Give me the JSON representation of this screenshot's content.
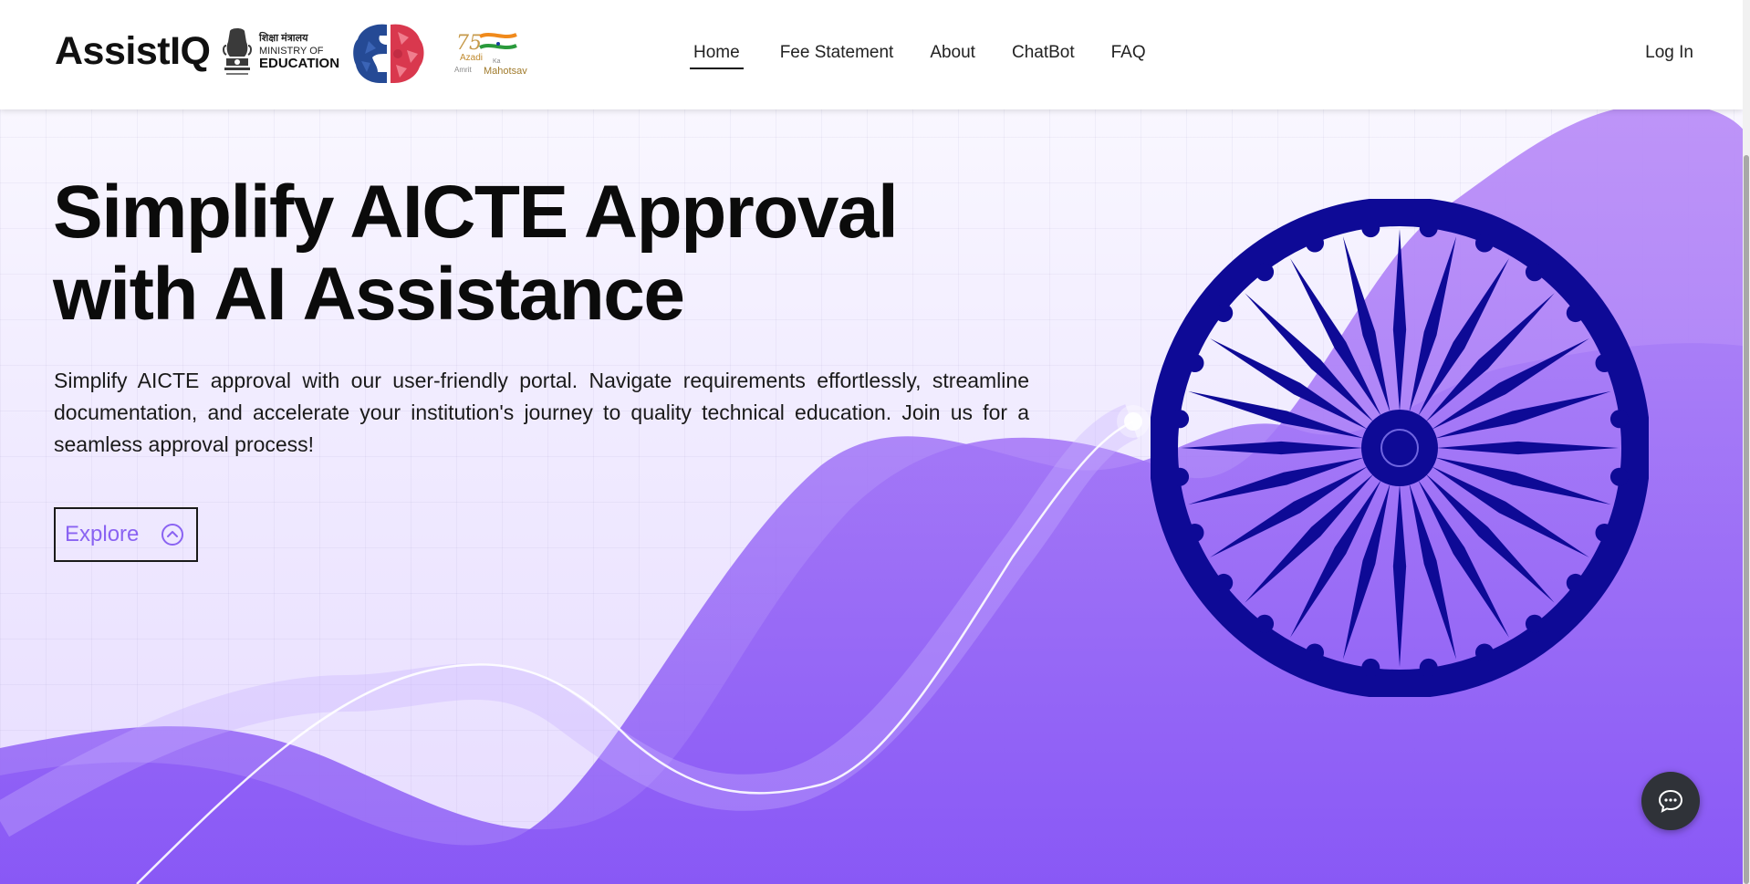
{
  "header": {
    "brand": "AssistIQ",
    "ministry": {
      "hindi": "शिक्षा मंत्रालय",
      "line1": "MINISTRY OF",
      "line2": "EDUCATION"
    },
    "azadi": {
      "line1": "Azadi",
      "line2": "Ka",
      "line3": "Amrit",
      "line4": "Mahotsav"
    },
    "nav": [
      {
        "label": "Home",
        "active": true
      },
      {
        "label": "Fee Statement",
        "active": false
      },
      {
        "label": "About",
        "active": false
      },
      {
        "label": "ChatBot",
        "active": false
      },
      {
        "label": "FAQ",
        "active": false
      }
    ],
    "login_label": "Log In"
  },
  "hero": {
    "title_line1": "Simplify AICTE Approval",
    "title_line2": "with AI Assistance",
    "description": "Simplify AICTE approval with our user-friendly portal. Navigate requirements effortlessly, streamline documentation, and accelerate your institution's journey to quality technical education. Join us for a seamless approval process!",
    "explore_label": "Explore"
  },
  "icons": {
    "emblem": "national-emblem-icon",
    "brain": "brain-logo-icon",
    "explore": "chevron-up-circle-icon",
    "wheel": "ashoka-chakra",
    "chat": "chat-bubble-icon"
  },
  "colors": {
    "accent": "#8a63f2",
    "wheel": "#0e0a96",
    "wave_dark": "#8656f5",
    "chat_button": "#2f3238"
  }
}
